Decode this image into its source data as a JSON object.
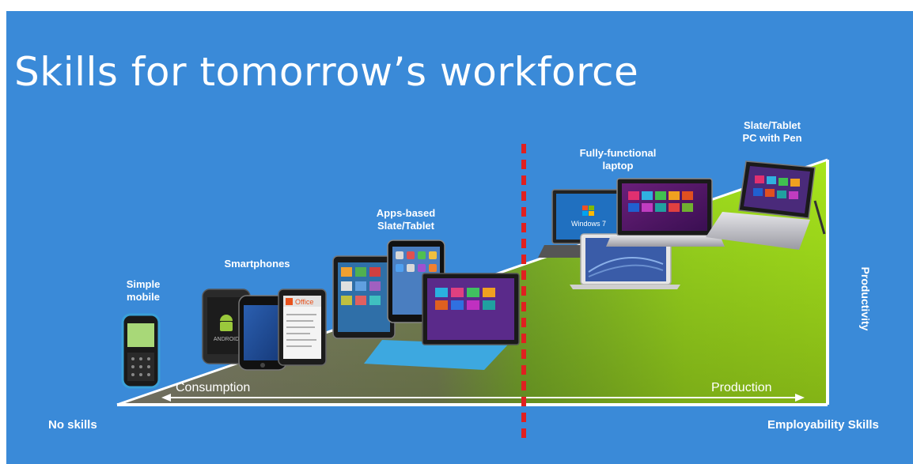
{
  "slide": {
    "title": "Skills for tomorrow’s workforce",
    "background_color": "#3a8ad8",
    "accent_divider_color": "#e02020",
    "production_gradient_color": "#9ee020"
  },
  "device_labels": {
    "simple_mobile": "Simple\nmobile",
    "smartphones": "Smartphones",
    "apps_tablet": "Apps-based\nSlate/Tablet",
    "laptop": "Fully-functional\nlaptop",
    "pen_tablet": "Slate/Tablet\nPC with Pen"
  },
  "axis": {
    "left_label": "No skills",
    "right_label": "Employability Skills",
    "vertical_label": "Productivity",
    "arrow_left": "Consumption",
    "arrow_right": "Production"
  },
  "screen_text": {
    "phone_brand": "ANDROID",
    "office_logo": "Office",
    "windows_logo": "Windows 7"
  },
  "icons": [
    "simple-phone-icon",
    "android-phone-icon",
    "iphone-icon",
    "office-phone-icon",
    "tablet-icon",
    "ipad-icon",
    "surface-tablet-icon",
    "windows7-laptop-icon",
    "macbook-icon",
    "windows8-laptop-icon",
    "pen-tablet-icon"
  ]
}
